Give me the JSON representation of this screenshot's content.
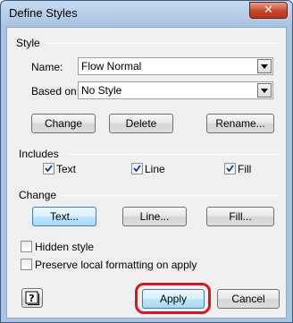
{
  "window": {
    "title": "Define Styles",
    "close_glyph": "✕"
  },
  "style_section": {
    "heading": "Style",
    "name_label": "Name:",
    "name_value": "Flow Normal",
    "based_on_label": "Based on:",
    "based_on_value": "No Style"
  },
  "style_buttons": {
    "change": "Change",
    "delete": "Delete",
    "rename": "Rename..."
  },
  "includes": {
    "heading": "Includes",
    "text": {
      "label": "Text",
      "checked": true
    },
    "line": {
      "label": "Line",
      "checked": true
    },
    "fill": {
      "label": "Fill",
      "checked": true
    }
  },
  "change_section": {
    "heading": "Change",
    "text_button": "Text...",
    "line_button": "Line...",
    "fill_button": "Fill..."
  },
  "options": {
    "hidden_style": "Hidden style",
    "preserve_local": "Preserve local formatting on apply"
  },
  "footer": {
    "help_icon": "help-question-icon",
    "apply": "Apply",
    "cancel": "Cancel"
  },
  "colors": {
    "highlight": "#e0141e",
    "title_bar": "#a9c4e2"
  }
}
